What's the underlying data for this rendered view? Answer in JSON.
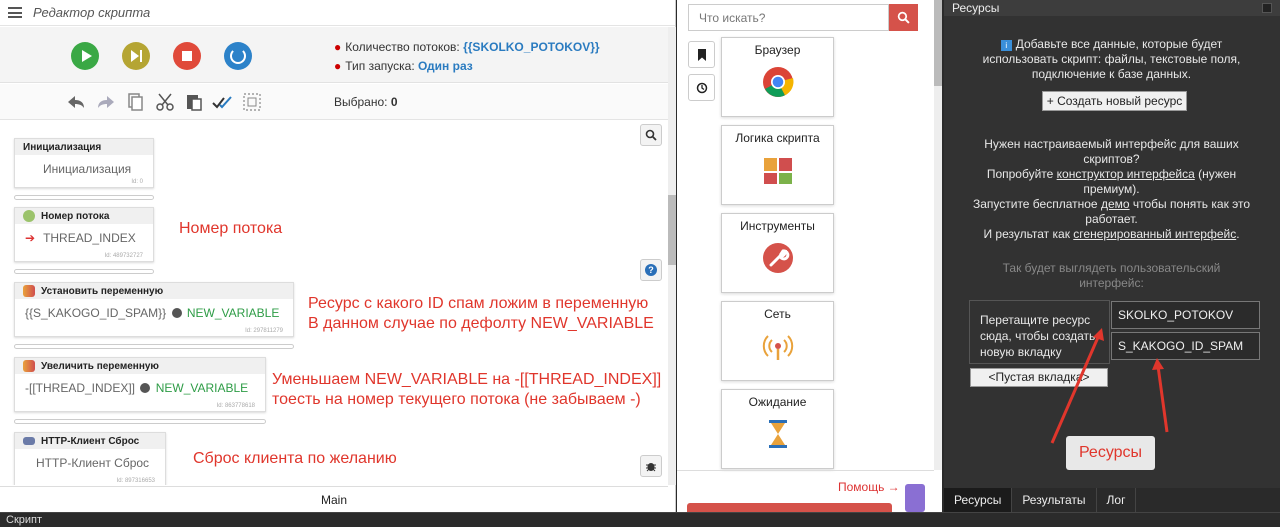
{
  "editor": {
    "title": "Редактор скрипта",
    "threads_label": "Количество потоков:",
    "threads_value": "{{SKOLKO_POTOKOV}}",
    "launch_label": "Тип запуска:",
    "launch_value": "Один раз",
    "selected_label": "Выбрано:",
    "selected_value": "0",
    "tab": "Main"
  },
  "blocks": [
    {
      "title": "Инициализация",
      "body": "Инициализация",
      "id": "Id: 0"
    },
    {
      "title": "Номер потока",
      "body": "THREAD_INDEX",
      "id": "Id: 489732727"
    },
    {
      "title": "Установить переменную",
      "body": "{{S_KAKOGO_ID_SPAM}}",
      "var": "NEW_VARIABLE",
      "id": "Id: 297811279"
    },
    {
      "title": "Увеличить переменную",
      "body": "-[[THREAD_INDEX]]",
      "var": "NEW_VARIABLE",
      "id": "Id: 863778618"
    },
    {
      "title": "HTTP-Клиент Сброс",
      "body": "HTTP-Клиент Сброс",
      "id": "Id: 897316653"
    }
  ],
  "annotations": {
    "a1": "Номер потока",
    "a2_line1": "Ресурс с какого ID спам ложим в переменную",
    "a2_line2": "В данном случае по дефолту NEW_VARIABLE",
    "a3_line1": "Уменьшаем NEW_VARIABLE на  -[[THREAD_INDEX]]",
    "a3_line2": "тоесть на номер текущего потока (не забываем -)",
    "a4": "Сброс клиента по желанию",
    "a5": "Ресурсы"
  },
  "actions_panel": {
    "search_placeholder": "Что искать?",
    "categories": [
      "Браузер",
      "Логика скрипта",
      "Инструменты",
      "Сеть",
      "Ожидание"
    ],
    "help": "Помощь →"
  },
  "resources": {
    "title": "Ресурсы",
    "intro_line1": "Добавьте все данные, которые будет",
    "intro_line2": "использовать скрипт: файлы, текстовые поля,",
    "intro_line3": "подключение к базе данных.",
    "create_button": "+ Создать новый ресурс",
    "ui_line1": "Нужен настраиваемый интерфейс для ваших",
    "ui_line2": "скриптов?",
    "ui_line3a": "Попробуйте ",
    "ui_line3_link": "конструктор интерфейса",
    "ui_line3b": " (нужен",
    "ui_line4": "премиум).",
    "ui_line5a": "Запустите бесплатное ",
    "ui_line5_link": "демо",
    "ui_line5b": " чтобы понять как это",
    "ui_line6": "работает.",
    "ui_line7a": "И результат как ",
    "ui_line7_link": "сгенерированный интерфейс",
    "ui_line7b": ".",
    "preview_line1": "Так будет выглядеть пользовательский",
    "preview_line2": "интерфейс:",
    "drop_hint": "Перетащите ресурс сюда, чтобы создать новую вкладку",
    "res1": "SKOLKO_POTOKOV",
    "res2": "S_KAKOGO_ID_SPAM",
    "empty_tab": "<Пустая вкладка>",
    "tabs": [
      "Ресурсы",
      "Результаты",
      "Лог"
    ]
  },
  "status": {
    "text": "Скрипт"
  },
  "colors": {
    "accent_red": "#e0362c",
    "link_blue": "#2a7bc0",
    "var_green": "#2e9c46"
  }
}
